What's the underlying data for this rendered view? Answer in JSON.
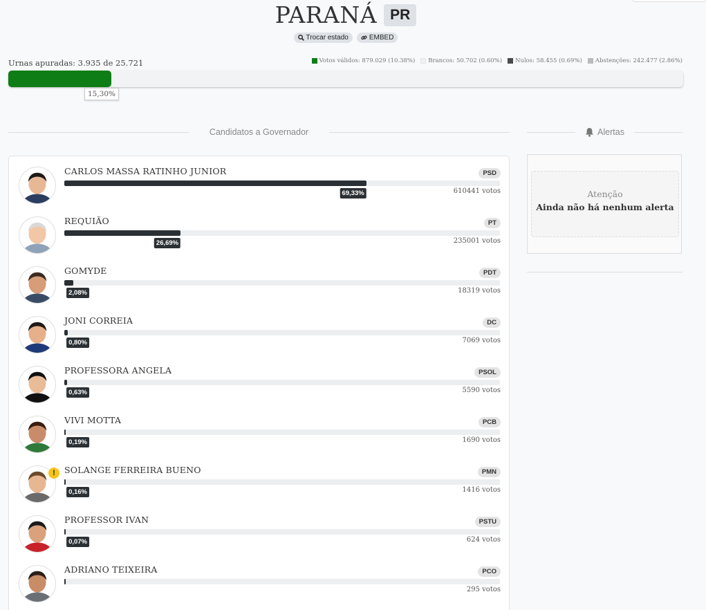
{
  "header": {
    "state_name": "PARANÁ",
    "state_uf": "PR",
    "buttons": {
      "change_state": "Trocar estado",
      "embed": "EMBED"
    }
  },
  "urnas": {
    "label": "Urnas apuradas: 3.935 de 25.721",
    "percent_label": "15,30%",
    "fraction": 0.153
  },
  "legend": [
    {
      "label": "Votos válidos: 879.029 (10.38%)",
      "color": "#0f7d16"
    },
    {
      "label": "Brancos: 50.702 (0.60%)",
      "color": "#f1f1f1"
    },
    {
      "label": "Nulos: 58.455 (0.69%)",
      "color": "#4a4a4a"
    },
    {
      "label": "Abstenções: 242.477 (2.86%)",
      "color": "#bbbbbb"
    }
  ],
  "sections": {
    "candidates_title": "Candidatos a Governador",
    "alerts_title": "Alertas"
  },
  "alerts": {
    "heading": "Atenção",
    "message": "Ainda não há nenhum alerta"
  },
  "candidates": [
    {
      "name": "CARLOS MASSA RATINHO JUNIOR",
      "party": "PSD",
      "percent_label": "69,33%",
      "percent": 69.33,
      "votes": "610441 votos",
      "warning": false
    },
    {
      "name": "REQUIÃO",
      "party": "PT",
      "percent_label": "26,69%",
      "percent": 26.69,
      "votes": "235001 votos",
      "warning": false
    },
    {
      "name": "GOMYDE",
      "party": "PDT",
      "percent_label": "2,08%",
      "percent": 2.08,
      "votes": "18319 votos",
      "warning": false
    },
    {
      "name": "JONI CORREIA",
      "party": "DC",
      "percent_label": "0,80%",
      "percent": 0.8,
      "votes": "7069 votos",
      "warning": false
    },
    {
      "name": "PROFESSORA ANGELA",
      "party": "PSOL",
      "percent_label": "0,63%",
      "percent": 0.63,
      "votes": "5590 votos",
      "warning": false
    },
    {
      "name": "VIVI MOTTA",
      "party": "PCB",
      "percent_label": "0,19%",
      "percent": 0.19,
      "votes": "1690 votos",
      "warning": false
    },
    {
      "name": "SOLANGE FERREIRA BUENO",
      "party": "PMN",
      "percent_label": "0,16%",
      "percent": 0.16,
      "votes": "1416 votos",
      "warning": true
    },
    {
      "name": "PROFESSOR IVAN",
      "party": "PSTU",
      "percent_label": "0,07%",
      "percent": 0.07,
      "votes": "624 votos",
      "warning": false
    },
    {
      "name": "ADRIANO TEIXEIRA",
      "party": "PCO",
      "percent_label": "",
      "percent": 0.03,
      "votes": "295 votos",
      "warning": false
    }
  ]
}
